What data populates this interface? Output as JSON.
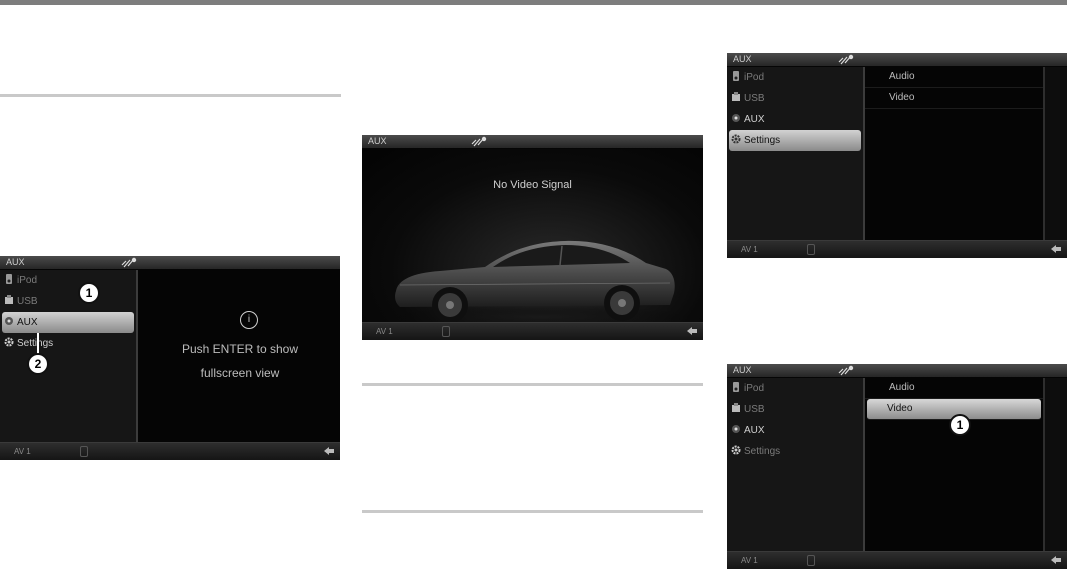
{
  "screens": {
    "s1": {
      "title": "AUX",
      "menu": [
        "iPod",
        "USB",
        "AUX",
        "Settings"
      ],
      "selected_menu": "AUX",
      "hint_icon": "i",
      "hint_line1": "Push ENTER to show",
      "hint_line2": "fullscreen view",
      "footer_channel": "AV 1",
      "callouts": [
        "1",
        "2"
      ]
    },
    "s2": {
      "title": "AUX",
      "message": "No Video Signal",
      "footer_channel": "AV 1"
    },
    "s3": {
      "title": "AUX",
      "menu": [
        "iPod",
        "USB",
        "AUX",
        "Settings"
      ],
      "selected_menu": "Settings",
      "submenu": [
        "Audio",
        "Video"
      ],
      "footer_channel": "AV 1"
    },
    "s4": {
      "title": "AUX",
      "menu": [
        "iPod",
        "USB",
        "AUX",
        "Settings"
      ],
      "submenu": [
        "Audio",
        "Video"
      ],
      "selected_submenu": "Video",
      "footer_channel": "AV 1",
      "callouts": [
        "1"
      ]
    }
  },
  "icons": {
    "ipod": "ipod-icon",
    "usb": "usb-icon",
    "aux": "aux-icon",
    "settings": "gear-icon",
    "signal": "antenna-icon",
    "back": "back-arrow-icon"
  },
  "colors": {
    "screen_bg": "#050505",
    "selection": "#c8c8c8",
    "rule": "#c9c9c9"
  }
}
